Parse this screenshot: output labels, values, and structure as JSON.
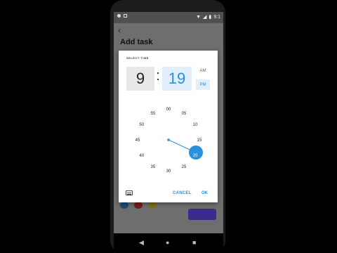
{
  "status_bar": {
    "time": "9:1"
  },
  "app": {
    "title": "Add task",
    "back_icon": "arrow-back-icon"
  },
  "dialog": {
    "select_time_label": "SELECT TIME",
    "hour": "9",
    "separator": ":",
    "minute": "19",
    "am_label": "AM",
    "pm_label": "PM",
    "selected_period": "PM",
    "clock_labels": [
      "00",
      "05",
      "10",
      "15",
      "20",
      "25",
      "30",
      "35",
      "40",
      "45",
      "50",
      "55"
    ],
    "selected_clock_label": "20",
    "cancel_label": "CANCEL",
    "ok_label": "OK",
    "accent_color": "#2a8fdc"
  },
  "background_buttons": {
    "colors": [
      "#2a8fdc",
      "#c0392b",
      "#d4c21a"
    ]
  }
}
